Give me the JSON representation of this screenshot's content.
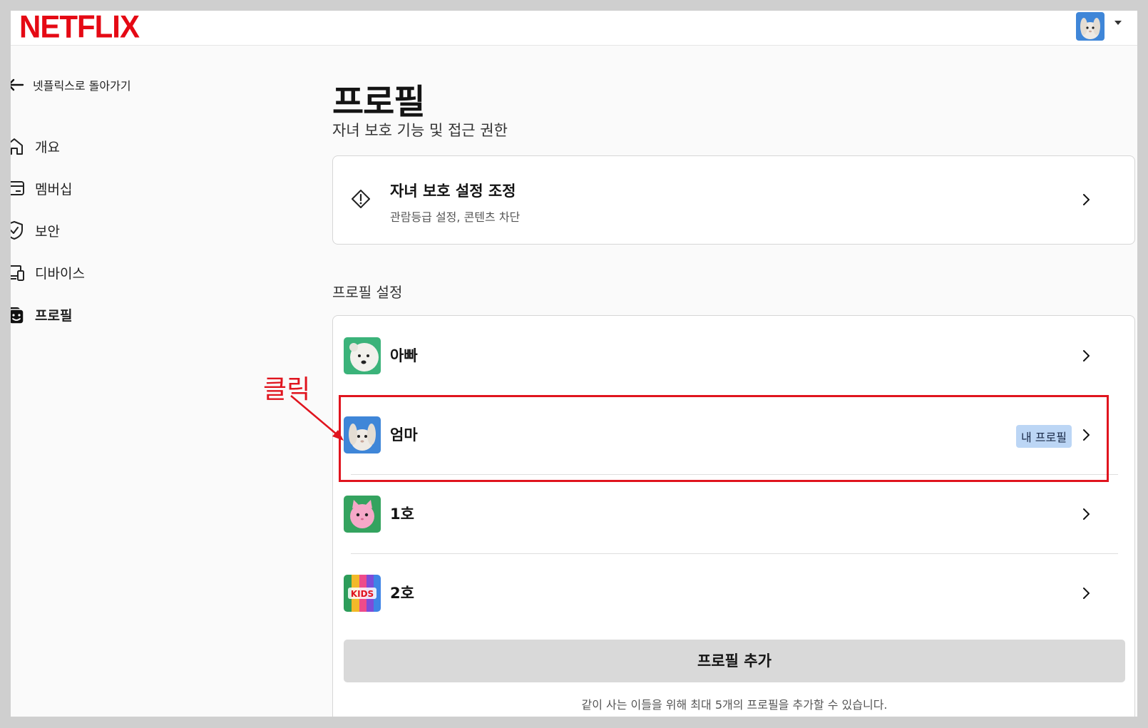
{
  "header": {
    "logo": "NETFLIX",
    "avatar_icon": "bunny-avatar-icon"
  },
  "sidebar": {
    "back_label": "넷플릭스로 돌아가기",
    "items": [
      {
        "label": "개요",
        "icon": "home-icon"
      },
      {
        "label": "멤버십",
        "icon": "card-icon"
      },
      {
        "label": "보안",
        "icon": "shield-icon"
      },
      {
        "label": "디바이스",
        "icon": "devices-icon"
      },
      {
        "label": "프로필",
        "icon": "profile-icon",
        "active": true
      }
    ]
  },
  "main": {
    "title": "프로필",
    "subtitle": "자녀 보호 기능 및 접근 권한",
    "parental": {
      "title": "자녀 보호 설정 조정",
      "subtitle": "관람등급 설정, 콘텐츠 차단"
    },
    "section_label": "프로필 설정",
    "profiles": [
      {
        "name": "아빠",
        "avatar": "polar-bear-avatar"
      },
      {
        "name": "엄마",
        "avatar": "bunny-avatar",
        "badge": "내 프로필"
      },
      {
        "name": "1호",
        "avatar": "pink-cat-avatar"
      },
      {
        "name": "2호",
        "avatar": "kids-avatar"
      }
    ],
    "add_button": "프로필 추가",
    "footnote": "같이 사는 이들을 위해 최대 5개의 프로필을 추가할 수 있습니다."
  },
  "annotation": {
    "text": "클릭",
    "color": "#e0141e"
  },
  "colors": {
    "brand": "#e50914",
    "badge_bg": "#bcd6f5"
  }
}
